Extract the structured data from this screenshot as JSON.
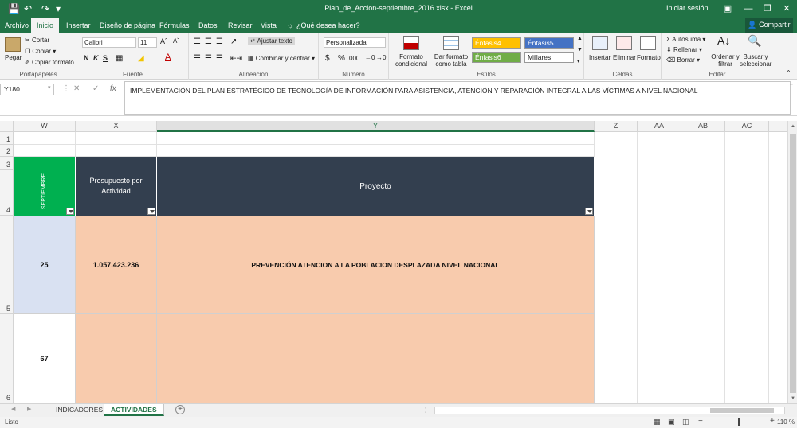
{
  "window": {
    "title": "Plan_de_Accion-septiembre_2016.xlsx - Excel",
    "signin": "Iniciar sesión",
    "accent": "#217346"
  },
  "tabs": [
    "Archivo",
    "Inicio",
    "Insertar",
    "Diseño de página",
    "Fórmulas",
    "Datos",
    "Revisar",
    "Vista"
  ],
  "active_tab": "Inicio",
  "tell_me": "¿Qué desea hacer?",
  "share": "Compartir",
  "ribbon": {
    "clipboard": {
      "label": "Portapapeles",
      "paste": "Pegar",
      "cut": "Cortar",
      "copy": "Copiar",
      "format_painter": "Copiar formato"
    },
    "font": {
      "label": "Fuente",
      "name": "Calibri",
      "size": "11",
      "bold": "N",
      "italic": "K",
      "underline": "S"
    },
    "alignment": {
      "label": "Alineación",
      "wrap": "Ajustar texto",
      "merge": "Combinar y centrar"
    },
    "number": {
      "label": "Número",
      "format": "Personalizada",
      "currency": "$",
      "percent": "%",
      "thousands": "000"
    },
    "styles": {
      "label": "Estilos",
      "conditional": "Formato condicional",
      "as_table": "Dar formato como tabla",
      "cells": [
        {
          "text": "Énfasis4",
          "bg": "#ffc000",
          "fg": "#ffffff"
        },
        {
          "text": "Énfasis5",
          "bg": "#4472c4",
          "fg": "#ffffff"
        },
        {
          "text": "Énfasis6",
          "bg": "#70ad47",
          "fg": "#ffffff"
        },
        {
          "text": "Millares",
          "bg": "#ffffff",
          "fg": "#222222"
        }
      ]
    },
    "cells": {
      "label": "Celdas",
      "insert": "Insertar",
      "delete": "Eliminar",
      "format": "Formato"
    },
    "editing": {
      "label": "Editar",
      "autosum": "Autosuma",
      "fill": "Rellenar",
      "clear": "Borrar",
      "sort": "Ordenar y filtrar",
      "find": "Buscar y seleccionar"
    }
  },
  "formula_bar": {
    "name_box": "Y180",
    "formula": "IMPLEMENTACIÓN DEL PLAN ESTRATÉGICO DE TECNOLOGÍA DE INFORMACIÓN PARA ASISTENCIA, ATENCIÓN Y REPARACIÓN INTEGRAL A LAS VÍCTIMAS A NIVEL NACIONAL"
  },
  "grid": {
    "columns": [
      "W",
      "X",
      "Y",
      "Z",
      "AA",
      "AB",
      "AC"
    ],
    "rows": [
      "1",
      "2",
      "3",
      "4",
      "5",
      "6"
    ],
    "header_month": "SEPTIEMBRE",
    "header_budget": "Presupuesto por Actividad",
    "header_project": "Proyecto",
    "row5": {
      "w": "25",
      "x": "1.057.423.236",
      "y": "PREVENCIÓN ATENCION A LA POBLACION DESPLAZADA NIVEL NACIONAL"
    },
    "row6": {
      "w": "67"
    },
    "colors": {
      "header_dark": "#333f4f",
      "green": "#00b050",
      "light_blue": "#d9e1f2",
      "salmon": "#f8cbad"
    }
  },
  "sheets": [
    "INDICADORES",
    "ACTIVIDADES"
  ],
  "active_sheet": "ACTIVIDADES",
  "status": {
    "mode": "Listo",
    "zoom": "110 %"
  }
}
